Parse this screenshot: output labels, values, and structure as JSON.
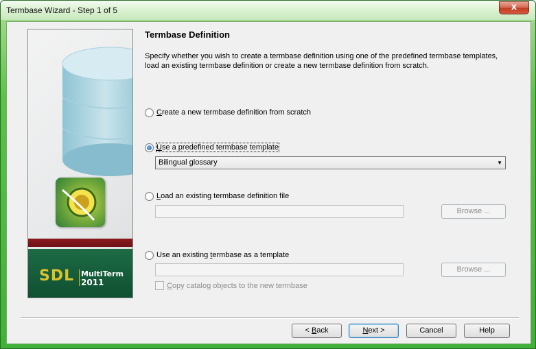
{
  "window": {
    "title": "Termbase Wizard - Step 1 of 5",
    "close_glyph": "x"
  },
  "banner": {
    "brand": "SDL",
    "product": "MultiTerm",
    "year": "2011"
  },
  "page": {
    "heading": "Termbase Definition",
    "description": "Specify whether you wish to create a termbase definition using one of the predefined termbase templates, load an existing termbase definition or create a new termbase definition from scratch."
  },
  "options": {
    "create_new": {
      "accel": "C",
      "rest": "reate a new termbase definition from scratch",
      "checked": false
    },
    "use_template": {
      "accel": "U",
      "rest": "se a predefined termbase template",
      "checked": true,
      "selected_value": "Bilingual glossary"
    },
    "load_file": {
      "accel": "L",
      "rest": "oad an existing termbase definition file",
      "checked": false,
      "value": "",
      "browse_label": "Browse ..."
    },
    "use_existing": {
      "pre": "Use an existing ",
      "accel": "t",
      "rest": "ermbase as a template",
      "checked": false,
      "value": "",
      "browse_label": "Browse ..."
    },
    "copy_catalog": {
      "accel": "C",
      "rest": "opy catalog objects to the new termbase",
      "checked": false
    }
  },
  "footer": {
    "back": {
      "pre": "< ",
      "accel": "B",
      "rest": "ack"
    },
    "next": {
      "accel": "N",
      "rest": "ext >"
    },
    "cancel": "Cancel",
    "help": "Help"
  },
  "icons": [
    "close-icon",
    "radio-icon",
    "dropdown-arrow-icon",
    "database-cylinder-icon",
    "multiterm-logo-icon",
    "checkbox-icon"
  ]
}
